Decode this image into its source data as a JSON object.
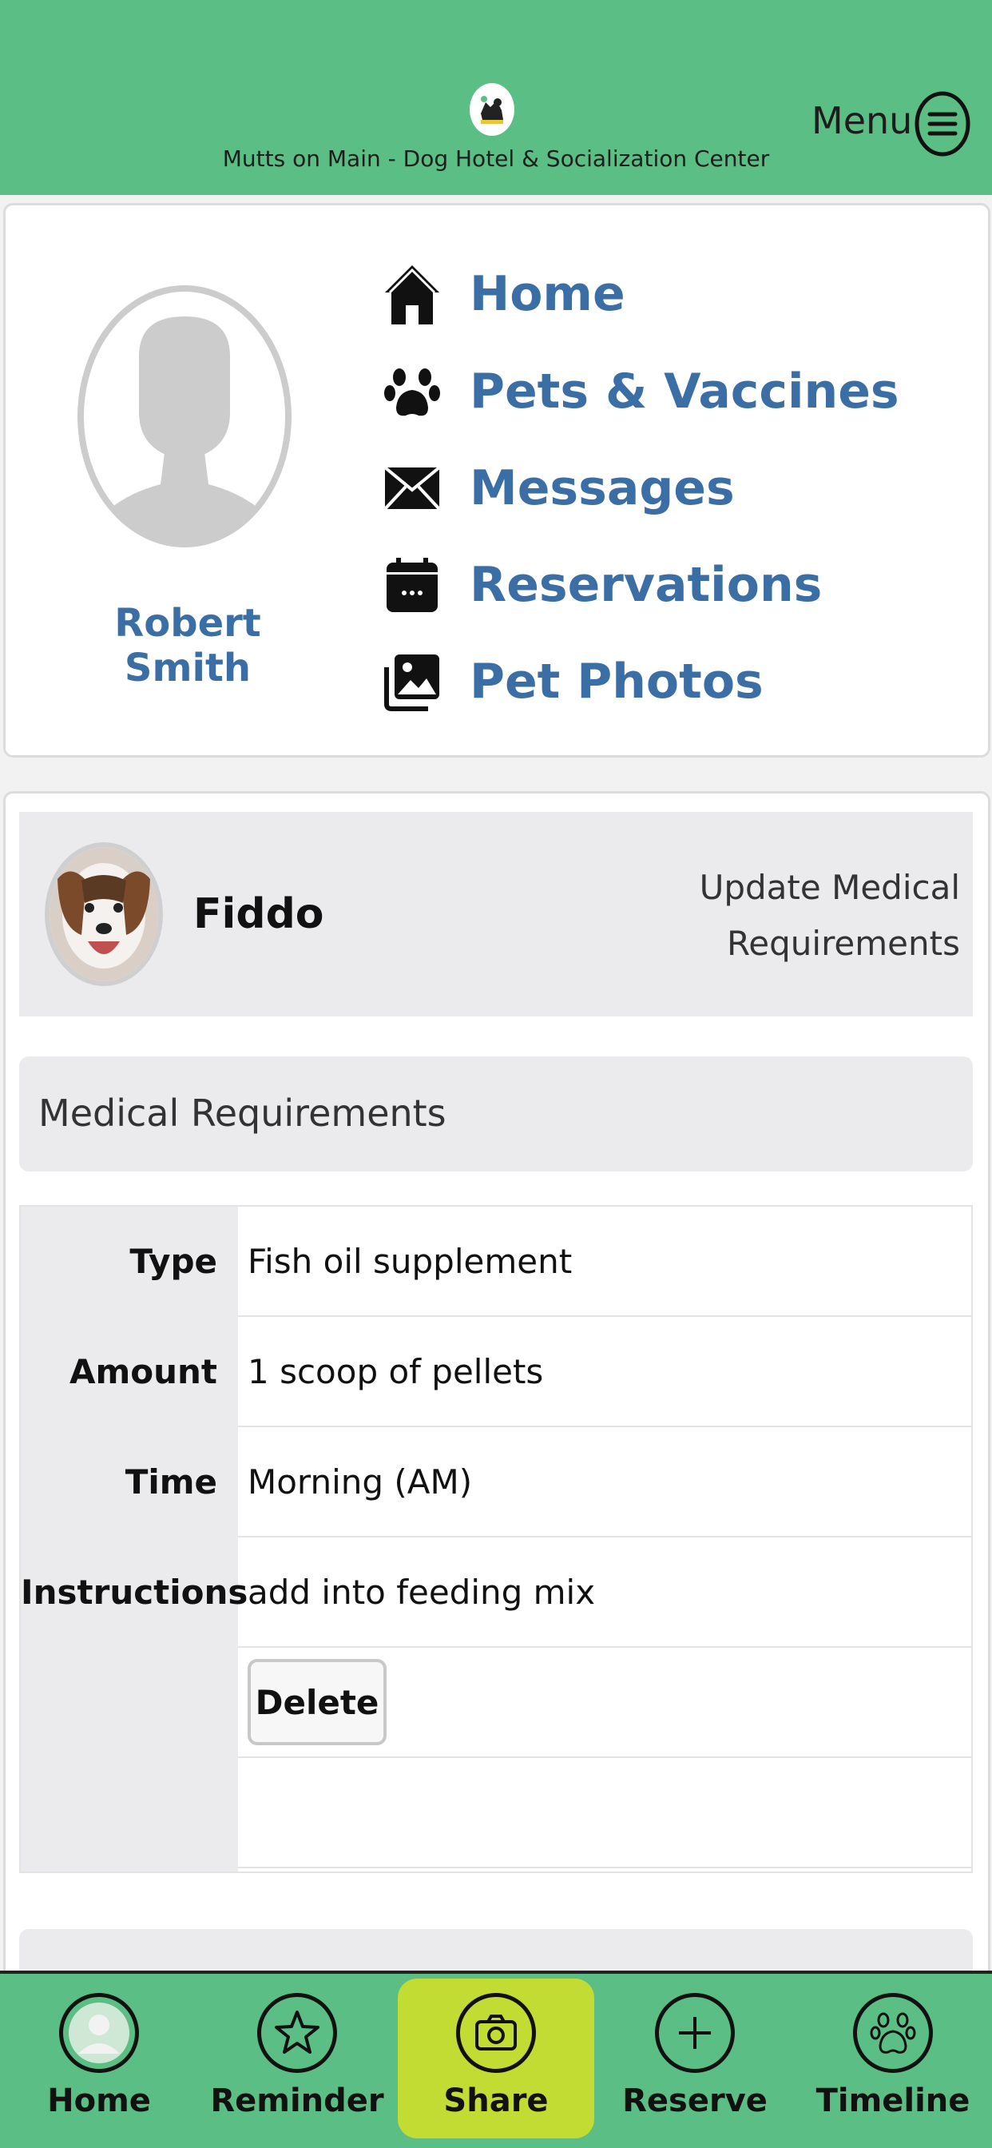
{
  "header": {
    "brand": "Mutts on Main - Dog Hotel & Socialization Center",
    "menu_label": "Menu",
    "logo_icon": "dog-logo-icon"
  },
  "profile": {
    "user_name": "Robert Smith",
    "nav": [
      {
        "label": "Home",
        "icon": "home-icon"
      },
      {
        "label": "Pets & Vaccines",
        "icon": "paw-icon"
      },
      {
        "label": "Messages",
        "icon": "envelope-icon"
      },
      {
        "label": "Reservations",
        "icon": "calendar-icon"
      },
      {
        "label": "Pet Photos",
        "icon": "photos-icon"
      }
    ]
  },
  "pet": {
    "name": "Fiddo",
    "update_link": "Update Medical Requirements"
  },
  "medical": {
    "section_title": "Medical Requirements",
    "rows": [
      {
        "label": "Type",
        "value": "Fish oil supplement"
      },
      {
        "label": "Amount",
        "value": "1 scoop of pellets"
      },
      {
        "label": "Time",
        "value": "Morning (AM)"
      },
      {
        "label": "Instructions",
        "value": "add into feeding mix"
      }
    ],
    "delete_label": "Delete"
  },
  "bottom_nav": [
    {
      "label": "Home",
      "icon": "user-icon"
    },
    {
      "label": "Reminder",
      "icon": "star-icon"
    },
    {
      "label": "Share",
      "icon": "camera-icon"
    },
    {
      "label": "Reserve",
      "icon": "plus-icon"
    },
    {
      "label": "Timeline",
      "icon": "paw-icon"
    }
  ],
  "colors": {
    "brand_green": "#5bbf85",
    "share_highlight": "#c2dc33",
    "link_blue": "#3b6ea5"
  }
}
